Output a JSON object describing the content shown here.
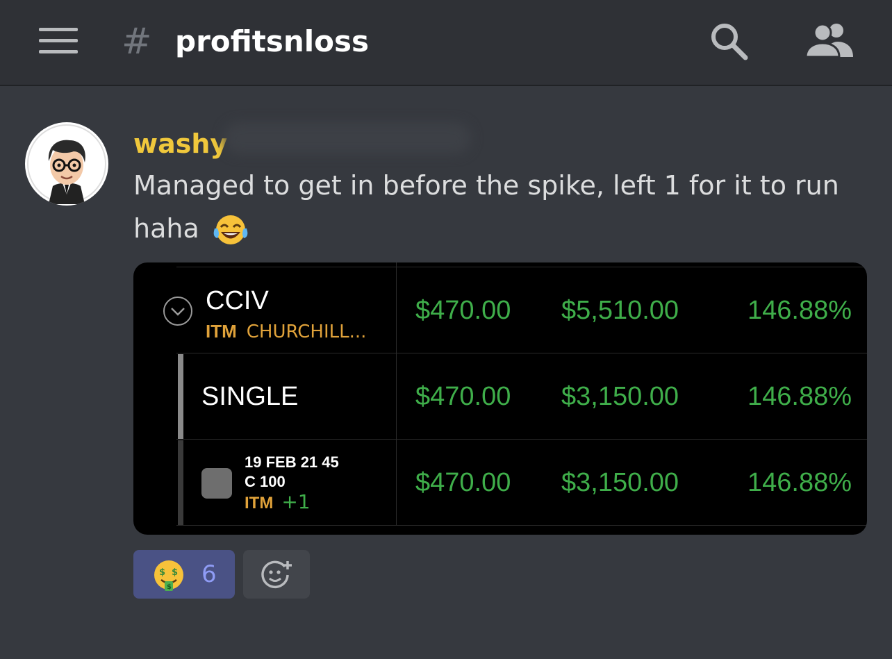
{
  "header": {
    "menu_icon": "hamburger-menu-icon",
    "hash_symbol": "#",
    "channel_name": "profitsnloss",
    "search_icon": "search-icon",
    "members_icon": "members-icon"
  },
  "message": {
    "author": "washy",
    "author_color": "#f0c83c",
    "text": "Managed to get in before the spike, left 1 for it to run haha",
    "emoji": "face-with-tears-of-joy-emoji"
  },
  "embed": {
    "rows": [
      {
        "label": "CCIV",
        "tag": "ITM",
        "sublabel": "CHURCHILL...",
        "col1": "$470.00",
        "col2": "$5,510.00",
        "col3": "146.88%"
      },
      {
        "label": "SINGLE",
        "col1": "$470.00",
        "col2": "$3,150.00",
        "col3": "146.88%"
      },
      {
        "line1": "19 FEB 21 45",
        "line2": "C 100",
        "tag": "ITM",
        "extra": "+1",
        "col1": "$470.00",
        "col2": "$3,150.00",
        "col3": "146.88%"
      }
    ],
    "value_color": "#3fae4a",
    "tag_color": "#e0a23a"
  },
  "reactions": [
    {
      "emoji": "money-mouth-face-emoji",
      "count": "6"
    }
  ],
  "add_reaction_icon": "add-reaction-icon"
}
